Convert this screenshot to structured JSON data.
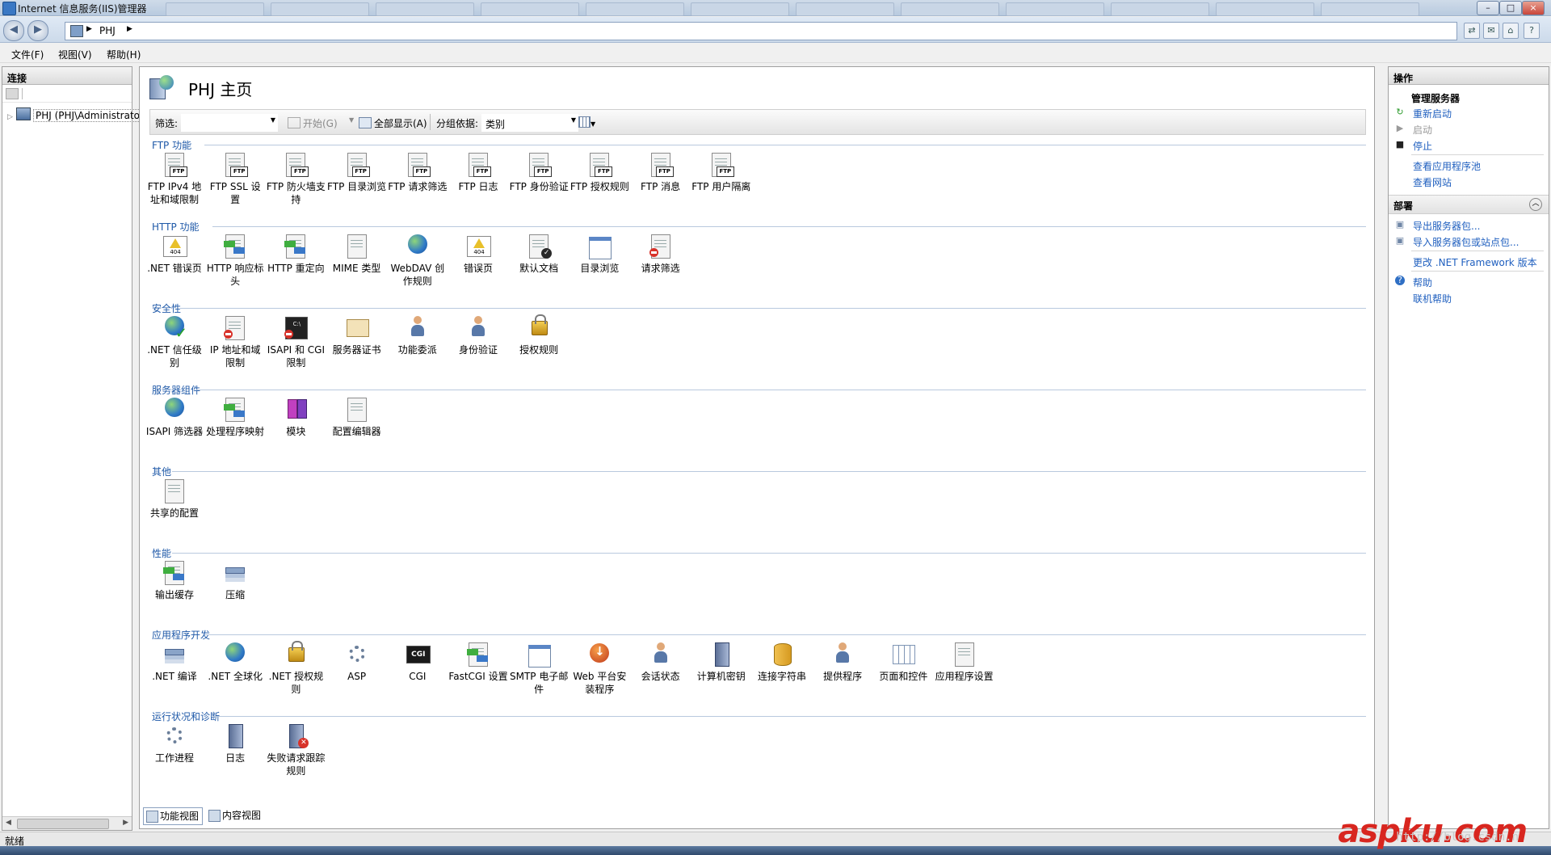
{
  "window": {
    "title": "Internet 信息服务(IIS)管理器"
  },
  "address": {
    "segments": [
      "PHJ"
    ]
  },
  "menu": [
    "文件(F)",
    "视图(V)",
    "帮助(H)"
  ],
  "connections": {
    "header": "连接",
    "tree_node": "PHJ (PHJ\\Administrator)"
  },
  "page": {
    "title": "PHJ 主页"
  },
  "filter": {
    "label": "筛选:",
    "start": "开始(G)",
    "show_all": "全部显示(A)",
    "group_by_label": "分组依据:",
    "group_by_value": "类别"
  },
  "sections": [
    {
      "title": "FTP 功能",
      "items": [
        {
          "icon": "ftp-ip-restrict-icon",
          "label": "FTP IPv4 地址和域限制"
        },
        {
          "icon": "ftp-ssl-icon",
          "label": "FTP SSL 设置"
        },
        {
          "icon": "ftp-firewall-icon",
          "label": "FTP 防火墙支持"
        },
        {
          "icon": "ftp-dir-browse-icon",
          "label": "FTP 目录浏览"
        },
        {
          "icon": "ftp-request-filter-icon",
          "label": "FTP 请求筛选"
        },
        {
          "icon": "ftp-log-icon",
          "label": "FTP 日志"
        },
        {
          "icon": "ftp-auth-icon",
          "label": "FTP 身份验证"
        },
        {
          "icon": "ftp-authz-icon",
          "label": "FTP 授权规则"
        },
        {
          "icon": "ftp-message-icon",
          "label": "FTP 消息"
        },
        {
          "icon": "ftp-user-isolation-icon",
          "label": "FTP 用户隔离"
        }
      ]
    },
    {
      "title": "HTTP 功能",
      "items": [
        {
          "icon": "net-error-page-icon",
          "label": ".NET 错误页"
        },
        {
          "icon": "http-response-headers-icon",
          "label": "HTTP 响应标头"
        },
        {
          "icon": "http-redirect-icon",
          "label": "HTTP 重定向"
        },
        {
          "icon": "mime-type-icon",
          "label": "MIME 类型"
        },
        {
          "icon": "webdav-icon",
          "label": "WebDAV 创作规则"
        },
        {
          "icon": "error-page-icon",
          "label": "错误页"
        },
        {
          "icon": "default-document-icon",
          "label": "默认文档"
        },
        {
          "icon": "directory-browse-icon",
          "label": "目录浏览"
        },
        {
          "icon": "request-filter-icon",
          "label": "请求筛选"
        }
      ]
    },
    {
      "title": "安全性",
      "items": [
        {
          "icon": "net-trust-icon",
          "label": ".NET 信任级别"
        },
        {
          "icon": "ip-restrict-icon",
          "label": "IP 地址和域限制"
        },
        {
          "icon": "isapi-cgi-icon",
          "label": "ISAPI 和 CGI 限制"
        },
        {
          "icon": "server-cert-icon",
          "label": "服务器证书"
        },
        {
          "icon": "feature-delegation-icon",
          "label": "功能委派"
        },
        {
          "icon": "authentication-icon",
          "label": "身份验证"
        },
        {
          "icon": "authorization-icon",
          "label": "授权规则"
        }
      ]
    },
    {
      "title": "服务器组件",
      "items": [
        {
          "icon": "isapi-filter-icon",
          "label": "ISAPI 筛选器"
        },
        {
          "icon": "handler-mapping-icon",
          "label": "处理程序映射"
        },
        {
          "icon": "modules-icon",
          "label": "模块"
        },
        {
          "icon": "config-editor-icon",
          "label": "配置编辑器"
        }
      ]
    },
    {
      "title": "其他",
      "items": [
        {
          "icon": "shared-config-icon",
          "label": "共享的配置"
        }
      ]
    },
    {
      "title": "性能",
      "items": [
        {
          "icon": "output-cache-icon",
          "label": "输出缓存"
        },
        {
          "icon": "compression-icon",
          "label": "压缩"
        }
      ]
    },
    {
      "title": "应用程序开发",
      "items": [
        {
          "icon": "net-compile-icon",
          "label": ".NET 编译"
        },
        {
          "icon": "net-globalization-icon",
          "label": ".NET 全球化"
        },
        {
          "icon": "net-authz-icon",
          "label": ".NET 授权规则"
        },
        {
          "icon": "asp-icon",
          "label": "ASP"
        },
        {
          "icon": "cgi-icon",
          "label": "CGI"
        },
        {
          "icon": "fastcgi-icon",
          "label": "FastCGI 设置"
        },
        {
          "icon": "smtp-icon",
          "label": "SMTP 电子邮件"
        },
        {
          "icon": "web-platform-icon",
          "label": "Web 平台安装程序"
        },
        {
          "icon": "session-state-icon",
          "label": "会话状态"
        },
        {
          "icon": "machine-key-icon",
          "label": "计算机密钥"
        },
        {
          "icon": "connection-string-icon",
          "label": "连接字符串"
        },
        {
          "icon": "providers-icon",
          "label": "提供程序"
        },
        {
          "icon": "pages-controls-icon",
          "label": "页面和控件"
        },
        {
          "icon": "app-settings-icon",
          "label": "应用程序设置"
        }
      ]
    },
    {
      "title": "运行状况和诊断",
      "items": [
        {
          "icon": "worker-process-icon",
          "label": "工作进程"
        },
        {
          "icon": "logging-icon",
          "label": "日志"
        },
        {
          "icon": "failed-request-tracing-icon",
          "label": "失败请求跟踪规则"
        }
      ]
    }
  ],
  "view_tabs": [
    "功能视图",
    "内容视图"
  ],
  "actions": {
    "header": "操作",
    "manage_server": "管理服务器",
    "restart": "重新启动",
    "start": "启动",
    "stop": "停止",
    "view_app_pools": "查看应用程序池",
    "view_sites": "查看网站",
    "deploy_header": "部署",
    "export_package": "导出服务器包...",
    "import_package": "导入服务器包或站点包...",
    "change_net": "更改 .NET Framework 版本",
    "help": "帮助",
    "online_help": "联机帮助"
  },
  "status": "就绪",
  "watermark": {
    "brand": "aspku.com",
    "url": "http://blog.csdn.n"
  },
  "colors": {
    "link": "#1f5fbf",
    "section": "#1f59a8"
  }
}
